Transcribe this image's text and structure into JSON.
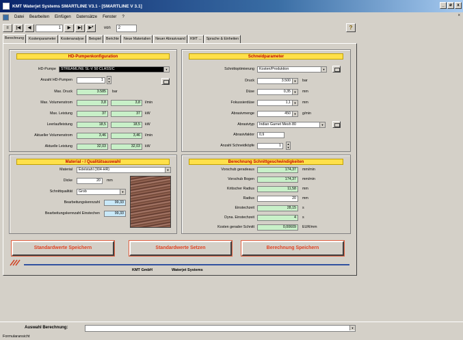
{
  "window": {
    "title": "KMT Waterjet Systems SMARTLINE V3.1 - [SMARTLINE V 3.1]",
    "controls": [
      "_",
      "ø",
      "x"
    ]
  },
  "menu": [
    "Datei",
    "Bearbeiten",
    "Einfügen",
    "Datensätze",
    "Fenster",
    "?"
  ],
  "toolbar": {
    "record": "1",
    "von_label": "von",
    "total": "2"
  },
  "tabs": [
    "Berechnung",
    "Kostenparameter",
    "Kostenanalyse",
    "Beispiel",
    "Berichte",
    "Neue Materialien",
    "Neuer Abrasivsand",
    "KMT ...",
    "Sprache & Einheiten"
  ],
  "pump": {
    "header": "HD-Pumpenkonfiguration",
    "pump_label": "HD-Pumpe",
    "pump_value": "STREAMLINE SL-V 50 CLASSIC",
    "count_label": "Anzahl HD-Pumpen",
    "count_value": "1",
    "rows": [
      {
        "label": "Max. Druck",
        "v1": "3.585",
        "v2": "",
        "unit": "bar"
      },
      {
        "label": "Max. Volumenstrom",
        "v1": "3,8",
        "v2": "3,8",
        "unit": "l/min"
      },
      {
        "label": "Max. Leistung",
        "v1": "37",
        "v2": "37",
        "unit": "kW"
      },
      {
        "label": "Leerlaufleistung",
        "v1": "18,5",
        "v2": "18,5",
        "unit": "kW"
      },
      {
        "label": "Aktueller Volumenstrom",
        "v1": "3,46",
        "v2": "3,46",
        "unit": "l/min"
      },
      {
        "label": "Aktuelle Leistung",
        "v1": "32,03",
        "v2": "32,03",
        "unit": "kW"
      }
    ]
  },
  "cut": {
    "header": "Schneidparameter",
    "opt_label": "Schnittoptimierung",
    "opt_value": "Kosten/Produktion",
    "rows": [
      {
        "label": "Druck",
        "value": "3.500",
        "unit": "bar"
      },
      {
        "label": "Düse",
        "value": "0,35",
        "unit": "mm"
      },
      {
        "label": "Fokussierdüse",
        "value": "1,1",
        "unit": "mm"
      },
      {
        "label": "Abrasivmenge",
        "value": "450",
        "unit": "g/min"
      }
    ],
    "abrasive_label": "Abrasivtyp",
    "abrasive_value": "Indian Garnet Mesh 80",
    "factor_label": "Abrasivfaktor",
    "factor_value": "0,9",
    "heads_label": "Anzahl Schneidköpfe",
    "heads_value": "1"
  },
  "material": {
    "header": "Material - / Qualitätsauswahl",
    "material_label": "Material",
    "material_value": "Edelstahl (304-HR)",
    "thickness_label": "Dicke",
    "thickness_value": "20",
    "thickness_unit": "mm",
    "quality_label": "Schnittqualität",
    "quality_value": "Grob",
    "machin_label": "Bearbeitungskennzahl",
    "machin_value": "99,33",
    "machin2_label": "Bearbeitungskennzahl Einstechen",
    "machin2_value": "99,33"
  },
  "speed": {
    "header": "Berechnung Schnittgeschwindigkeiten",
    "rows": [
      {
        "label": "Vorschub geradeaus",
        "value": "174,37",
        "unit": "mm/min"
      },
      {
        "label": "Vorschub Bogen",
        "value": "174,37",
        "unit": "mm/min"
      },
      {
        "label": "Kritischer Radius",
        "value": "11,58",
        "unit": "mm"
      },
      {
        "label": "Radius",
        "value": "20",
        "unit": "mm"
      },
      {
        "label": "Einstechzeit",
        "value": "28,15",
        "unit": "s"
      },
      {
        "label": "Dyna. Einstechzeit",
        "value": "4",
        "unit": "s"
      },
      {
        "label": "Kosten gerader Schnitt",
        "value": "0,00609",
        "unit": "EUR/mm"
      }
    ]
  },
  "buttons": {
    "save_std": "Standardwerte Speichern",
    "set_std": "Standardwerte Setzen",
    "save_calc": "Berechnung Speichern"
  },
  "footer": {
    "company": "KMT GmbH",
    "product": "Waterjet Systems"
  },
  "bottom": {
    "select_label": "Auswahl Berechnung:",
    "status": "Formularansicht"
  }
}
